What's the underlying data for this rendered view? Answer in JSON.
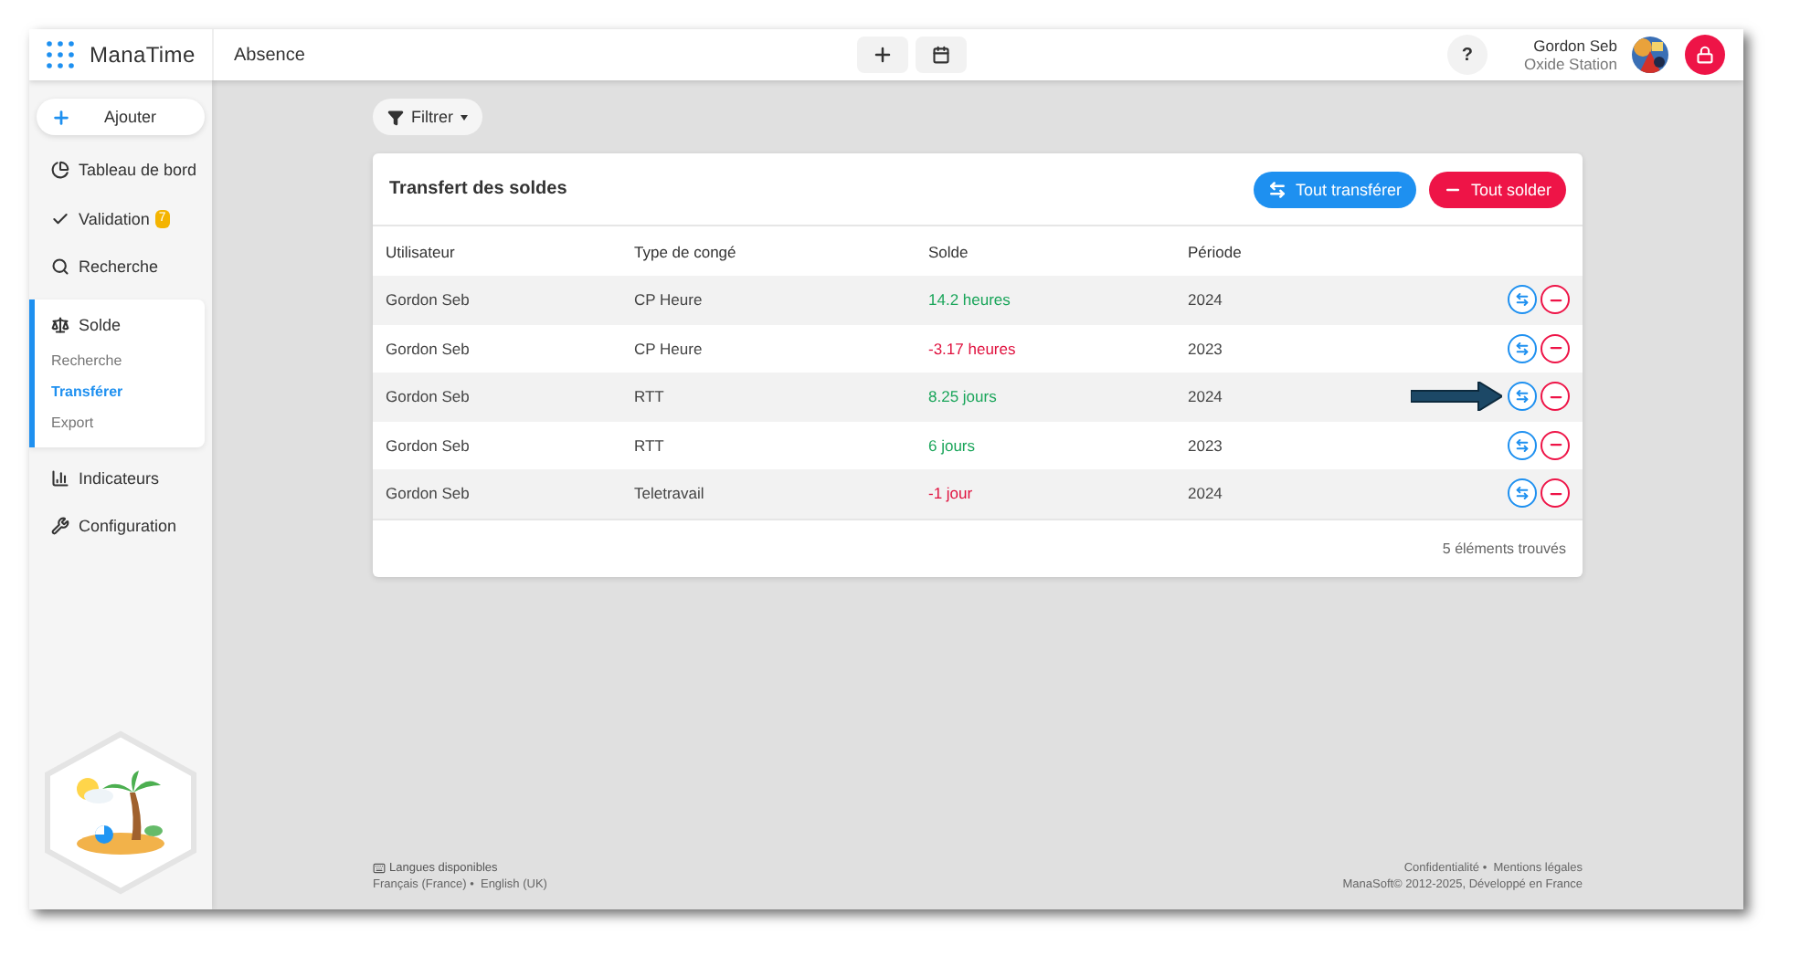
{
  "header": {
    "brand": "ManaTime",
    "module": "Absence",
    "help": "?",
    "user": {
      "name": "Gordon Seb",
      "company": "Oxide Station"
    }
  },
  "sidebar": {
    "add_button": "Ajouter",
    "items": [
      {
        "kind": "dashboard",
        "label": "Tableau de bord"
      },
      {
        "kind": "validation",
        "label": "Validation",
        "badge": "7"
      },
      {
        "kind": "search",
        "label": "Recherche"
      },
      {
        "kind": "balance",
        "label": "Solde",
        "expanded": true,
        "children": [
          {
            "label": "Recherche",
            "selected": false
          },
          {
            "label": "Transférer",
            "selected": true
          },
          {
            "label": "Export",
            "selected": false
          }
        ]
      },
      {
        "kind": "indicators",
        "label": "Indicateurs"
      },
      {
        "kind": "settings",
        "label": "Configuration"
      }
    ]
  },
  "filter": {
    "label": "Filtrer"
  },
  "card": {
    "title": "Transfert des soldes",
    "actions": [
      {
        "kind": "transfer",
        "label": "Tout transférer"
      },
      {
        "kind": "settle",
        "label": "Tout solder"
      }
    ],
    "columns": [
      "Utilisateur",
      "Type de congé",
      "Solde",
      "Période"
    ],
    "rows": [
      {
        "user": "Gordon Seb",
        "type": "CP Heure",
        "balance": "14.2 heures",
        "color": "#1aa55a",
        "period": "2024",
        "pointer": false
      },
      {
        "user": "Gordon Seb",
        "type": "CP Heure",
        "balance": "-3.17 heures",
        "color": "#e0123f",
        "period": "2023",
        "pointer": false
      },
      {
        "user": "Gordon Seb",
        "type": "RTT",
        "balance": "8.25 jours",
        "color": "#1aa55a",
        "period": "2024",
        "pointer": true
      },
      {
        "user": "Gordon Seb",
        "type": "RTT",
        "balance": "6 jours",
        "color": "#1aa55a",
        "period": "2023",
        "pointer": false
      },
      {
        "user": "Gordon Seb",
        "type": "Teletravail",
        "balance": "-1 jour",
        "color": "#e0123f",
        "period": "2024",
        "pointer": false
      }
    ],
    "count": "5 éléments trouvés"
  },
  "footer": {
    "languages_title": "Langues disponibles",
    "languages": "Français (France) •  English (UK)",
    "links": "Confidentialité •  Mentions légales",
    "copyright": "ManaSoft© 2012-2025, Développé en France"
  }
}
